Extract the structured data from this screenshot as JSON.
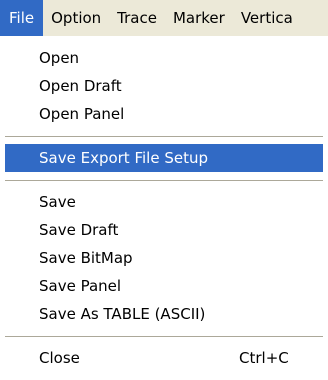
{
  "menubar": {
    "items": [
      {
        "label": "File"
      },
      {
        "label": "Option"
      },
      {
        "label": "Trace"
      },
      {
        "label": "Marker"
      },
      {
        "label": "Vertica"
      }
    ]
  },
  "file_menu": {
    "items": [
      {
        "label": "Open"
      },
      {
        "label": "Open Draft"
      },
      {
        "label": "Open Panel"
      },
      {
        "label": "Save Export File Setup"
      },
      {
        "label": "Save"
      },
      {
        "label": "Save Draft"
      },
      {
        "label": "Save BitMap"
      },
      {
        "label": "Save Panel"
      },
      {
        "label": "Save As TABLE (ASCII)"
      },
      {
        "label": "Close",
        "shortcut": "Ctrl+C"
      }
    ],
    "highlighted_item": "Save Export File Setup",
    "colors": {
      "highlight": "#316ac5",
      "menubar_bg": "#ece9d8"
    }
  }
}
